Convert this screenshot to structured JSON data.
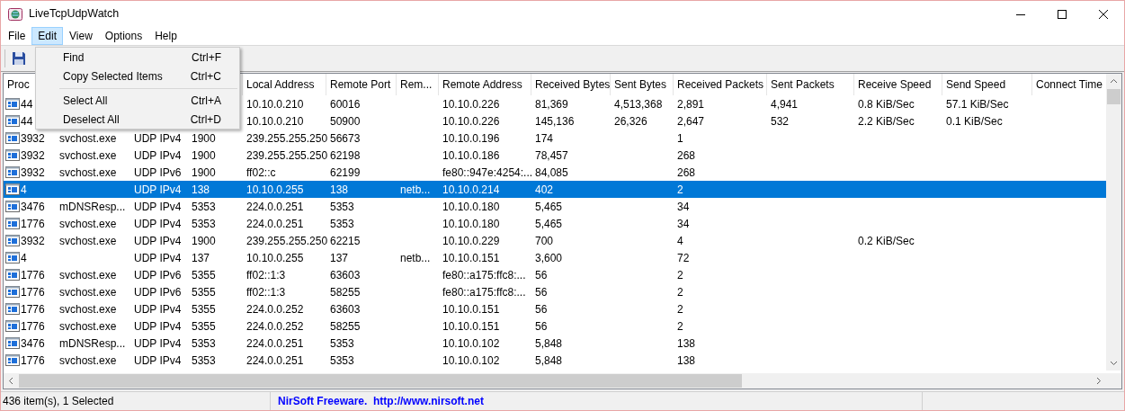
{
  "window": {
    "title": "LiveTcpUdpWatch"
  },
  "menu_bar": [
    {
      "label": "File",
      "selected": false
    },
    {
      "label": "Edit",
      "selected": true
    },
    {
      "label": "View",
      "selected": false
    },
    {
      "label": "Options",
      "selected": false
    },
    {
      "label": "Help",
      "selected": false
    }
  ],
  "open_menu": {
    "items": [
      {
        "kind": "item",
        "label": "Find",
        "shortcut": "Ctrl+F"
      },
      {
        "kind": "item",
        "label": "Copy Selected Items",
        "shortcut": "Ctrl+C"
      },
      {
        "kind": "separator"
      },
      {
        "kind": "item",
        "label": "Select All",
        "shortcut": "Ctrl+A"
      },
      {
        "kind": "item",
        "label": "Deselect All",
        "shortcut": "Ctrl+D"
      }
    ]
  },
  "table": {
    "columns": [
      "Proc",
      null,
      null,
      null,
      "Local Address",
      "Remote Port",
      "Rem...",
      "Remote Address",
      "Received Bytes",
      "Sent Bytes",
      "Received Packets",
      "Sent Packets",
      "Receive Speed",
      "Send Speed",
      "Connect Time"
    ],
    "rows": [
      {
        "selected": false,
        "cells": [
          "44",
          null,
          null,
          null,
          "10.10.0.210",
          "60016",
          null,
          "10.10.0.226",
          "81,369",
          "4,513,368",
          "2,891",
          "4,941",
          "0.8 KiB/Sec",
          "57.1 KiB/Sec"
        ]
      },
      {
        "selected": false,
        "cells": [
          "44",
          null,
          null,
          null,
          "10.10.0.210",
          "50900",
          null,
          "10.10.0.226",
          "145,136",
          "26,326",
          "2,647",
          "532",
          "2.2 KiB/Sec",
          "0.1 KiB/Sec"
        ]
      },
      {
        "selected": false,
        "cells": [
          "3932",
          "svchost.exe",
          "UDP IPv4",
          "1900",
          "239.255.255.250",
          "56673",
          null,
          "10.10.0.196",
          "174",
          null,
          "1"
        ]
      },
      {
        "selected": false,
        "cells": [
          "3932",
          "svchost.exe",
          "UDP IPv4",
          "1900",
          "239.255.255.250",
          "62198",
          null,
          "10.10.0.186",
          "78,457",
          null,
          "268"
        ]
      },
      {
        "selected": false,
        "cells": [
          "3932",
          "svchost.exe",
          "UDP IPv6",
          "1900",
          "ff02::c",
          "62199",
          null,
          "fe80::947e:4254:...",
          "84,085",
          null,
          "268"
        ]
      },
      {
        "selected": true,
        "cells": [
          "4",
          null,
          "UDP IPv4",
          "138",
          "10.10.0.255",
          "138",
          "netb...",
          "10.10.0.214",
          "402",
          null,
          "2"
        ]
      },
      {
        "selected": false,
        "cells": [
          "3476",
          "mDNSResp...",
          "UDP IPv4",
          "5353",
          "224.0.0.251",
          "5353",
          null,
          "10.10.0.180",
          "5,465",
          null,
          "34"
        ]
      },
      {
        "selected": false,
        "cells": [
          "1776",
          "svchost.exe",
          "UDP IPv4",
          "5353",
          "224.0.0.251",
          "5353",
          null,
          "10.10.0.180",
          "5,465",
          null,
          "34"
        ]
      },
      {
        "selected": false,
        "cells": [
          "3932",
          "svchost.exe",
          "UDP IPv4",
          "1900",
          "239.255.255.250",
          "62215",
          null,
          "10.10.0.229",
          "700",
          null,
          "4",
          null,
          "0.2 KiB/Sec"
        ]
      },
      {
        "selected": false,
        "cells": [
          "4",
          null,
          "UDP IPv4",
          "137",
          "10.10.0.255",
          "137",
          "netb...",
          "10.10.0.151",
          "3,600",
          null,
          "72"
        ]
      },
      {
        "selected": false,
        "cells": [
          "1776",
          "svchost.exe",
          "UDP IPv6",
          "5355",
          "ff02::1:3",
          "63603",
          null,
          "fe80::a175:ffc8:...",
          "56",
          null,
          "2"
        ]
      },
      {
        "selected": false,
        "cells": [
          "1776",
          "svchost.exe",
          "UDP IPv6",
          "5355",
          "ff02::1:3",
          "58255",
          null,
          "fe80::a175:ffc8:...",
          "56",
          null,
          "2"
        ]
      },
      {
        "selected": false,
        "cells": [
          "1776",
          "svchost.exe",
          "UDP IPv4",
          "5355",
          "224.0.0.252",
          "63603",
          null,
          "10.10.0.151",
          "56",
          null,
          "2"
        ]
      },
      {
        "selected": false,
        "cells": [
          "1776",
          "svchost.exe",
          "UDP IPv4",
          "5355",
          "224.0.0.252",
          "58255",
          null,
          "10.10.0.151",
          "56",
          null,
          "2"
        ]
      },
      {
        "selected": false,
        "cells": [
          "3476",
          "mDNSResp...",
          "UDP IPv4",
          "5353",
          "224.0.0.251",
          "5353",
          null,
          "10.10.0.102",
          "5,848",
          null,
          "138"
        ]
      },
      {
        "selected": false,
        "cells": [
          "1776",
          "svchost.exe",
          "UDP IPv4",
          "5353",
          "224.0.0.251",
          "5353",
          null,
          "10.10.0.102",
          "5,848",
          null,
          "138"
        ]
      }
    ]
  },
  "status_bar": [
    {
      "kind": "text",
      "text": "436 item(s), 1 Selected"
    },
    {
      "kind": "link",
      "text": "NirSoft Freeware.  http://www.nirsoft.net"
    }
  ]
}
